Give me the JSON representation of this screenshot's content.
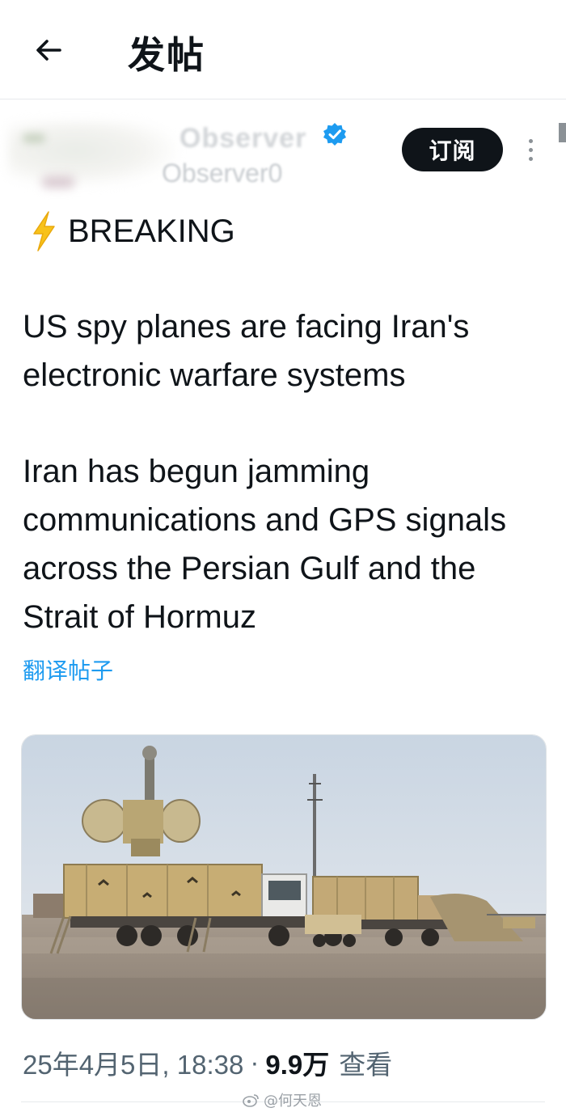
{
  "header": {
    "title": "发帖",
    "back_icon": "arrow-left-icon"
  },
  "author": {
    "display_name": "Observer",
    "handle": "Observer0",
    "verified_icon": "verified-badge-icon",
    "verified_color": "#1d9bf0"
  },
  "actions": {
    "subscribe_label": "订阅",
    "more_icon": "more-vertical-icon"
  },
  "tweet": {
    "breaking_icon": "lightning-bolt-icon",
    "breaking_label": "BREAKING",
    "paragraph_1": "US spy planes are facing Iran's electronic warfare systems",
    "paragraph_2": "Iran has begun jamming communications and GPS signals across the Persian Gulf and the Strait of Hormuz",
    "translate_label": "翻译帖子"
  },
  "media": {
    "alt": "military electronic warfare trucks with radar dishes in desert"
  },
  "meta": {
    "timestamp": "25年4月5日, 18:38",
    "separator": "·",
    "views_count": "9.9万",
    "views_label": "查看"
  },
  "watermark": {
    "text": "@何天恩"
  },
  "colors": {
    "accent": "#1d9bf0",
    "text": "#0f1419",
    "secondary": "#536471"
  }
}
